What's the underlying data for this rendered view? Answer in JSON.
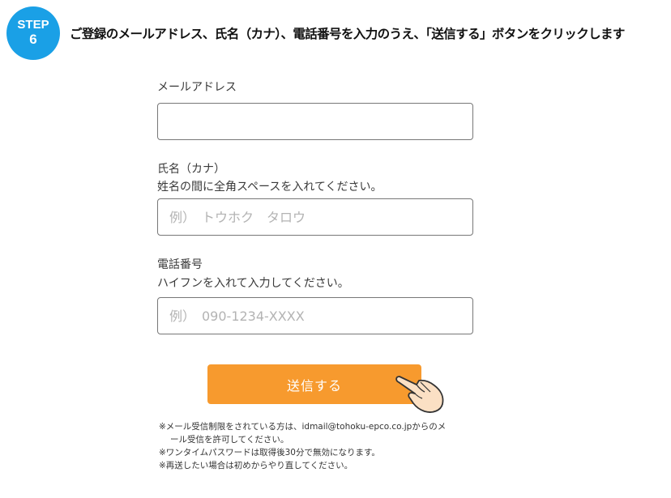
{
  "step": {
    "word": "STEP",
    "number": "6",
    "color": "#1aa0e6"
  },
  "instruction": "ご登録のメールアドレス、氏名（カナ）、電話番号を入力のうえ、「送信する」ボタンをクリックします",
  "form": {
    "email": {
      "label": "メールアドレス",
      "value": "",
      "placeholder": ""
    },
    "name": {
      "label": "氏名（カナ）",
      "help": "姓名の間に全角スペースを入れてください。",
      "value": "",
      "placeholder": "例）　トウホク　タロウ"
    },
    "phone": {
      "label": "電話番号",
      "help": "ハイフンを入れて入力してください。",
      "value": "",
      "placeholder": "例）　090-1234-XXXX"
    },
    "submit_label": "送信する",
    "submit_color": "#f79a2e"
  },
  "pointer": {
    "icon": "hand-pointer-icon"
  },
  "notes": [
    "※メール受信制限をされている方は、idmail@tohoku-epco.co.jpからのメ",
    "ール受信を許可してください。",
    "※ワンタイムパスワードは取得後30分で無効になります。",
    "※再送したい場合は初めからやり直してください。"
  ]
}
